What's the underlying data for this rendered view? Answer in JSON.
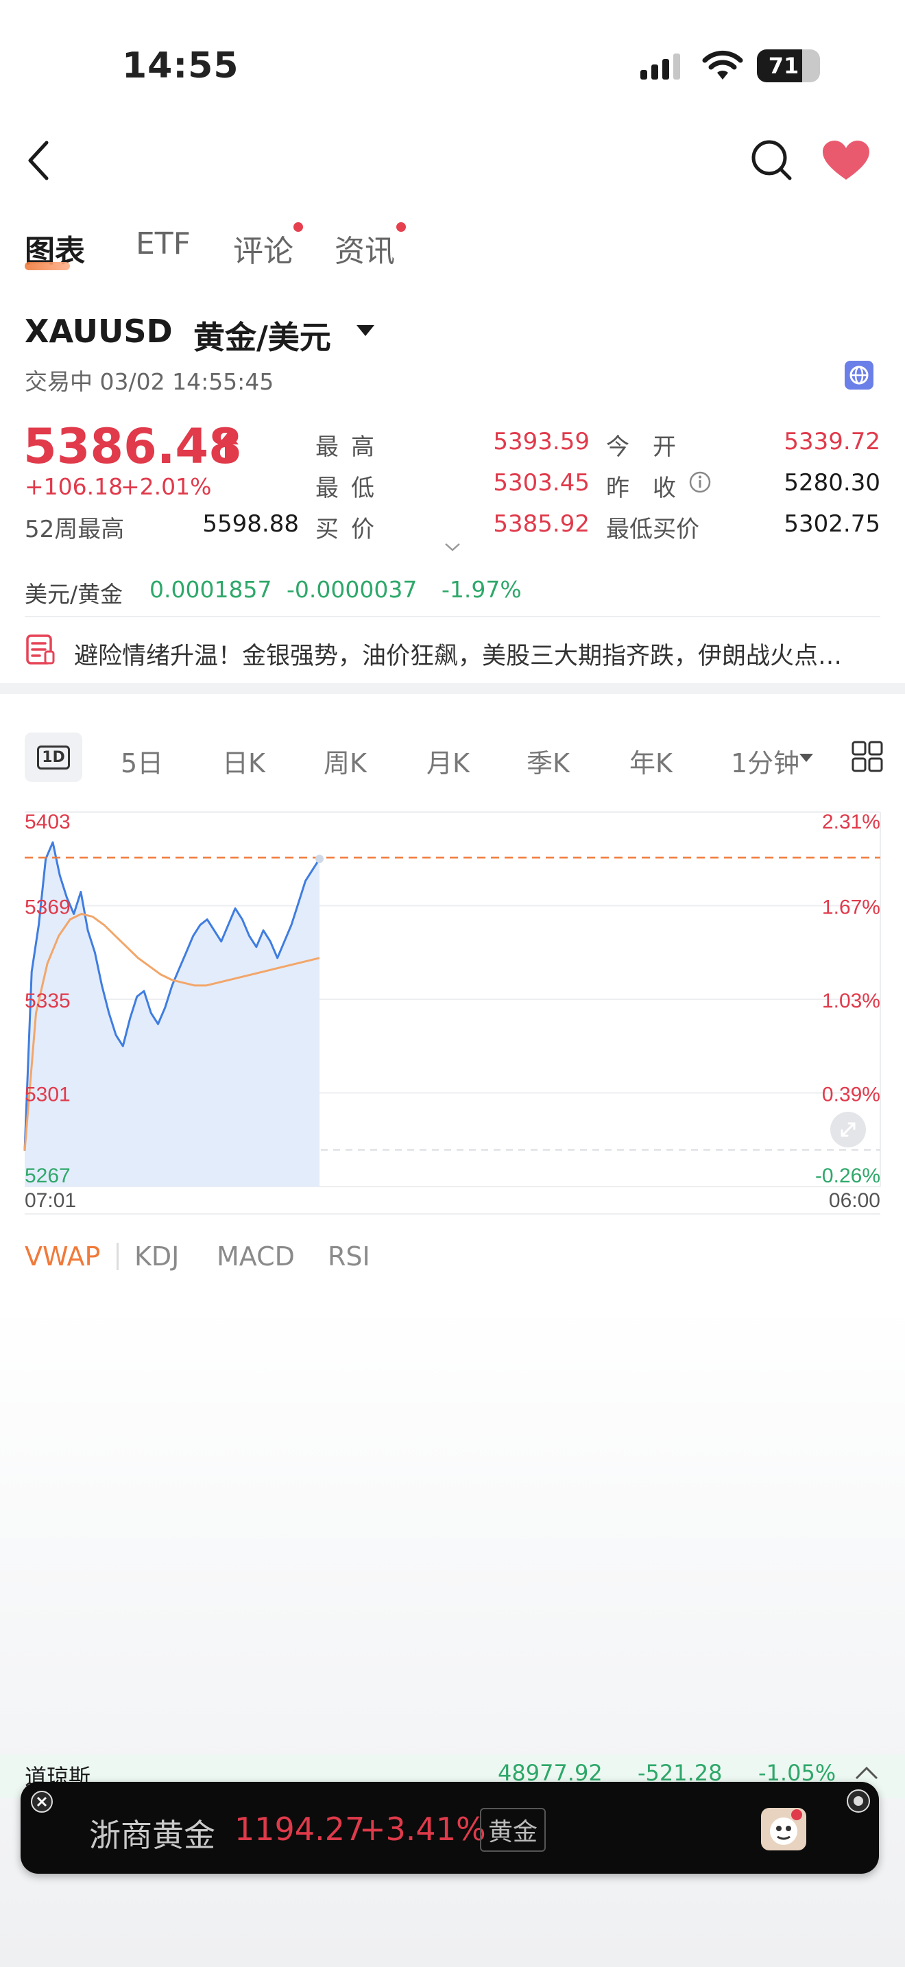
{
  "status_bar": {
    "time": "14:55",
    "battery": "71"
  },
  "tabs": [
    {
      "label": "图表"
    },
    {
      "label": "ETF"
    },
    {
      "label": "评论"
    },
    {
      "label": "资讯"
    }
  ],
  "header": {
    "symbol": "XAUUSD",
    "name": "黄金/美元",
    "status": "交易中 03/02 14:55:45"
  },
  "quote": {
    "price": "5386.48",
    "change": "+106.18",
    "change_pct": "+2.01%",
    "high_label": "最高",
    "high": "5393.59",
    "open_label": "今开",
    "open": "5339.72",
    "low_label": "最低",
    "low": "5303.45",
    "prev_close_label": "昨收",
    "prev_close": "5280.30",
    "w52_label": "52周最高",
    "w52_high": "5598.88",
    "bid_label": "买价",
    "bid": "5385.92",
    "min_bid_label": "最低买价",
    "min_bid": "5302.75"
  },
  "cross": {
    "label": "美元/黄金",
    "value": "0.0001857",
    "change": "-0.0000037",
    "pct": "-1.97%"
  },
  "news": {
    "text": "避险情绪升温！金银强势，油价狂飙，美股三大期指齐跌，伊朗战火点…"
  },
  "timeframes": {
    "active": "1D",
    "items": [
      "5日",
      "日K",
      "周K",
      "月K",
      "季K",
      "年K"
    ],
    "interval": "1分钟"
  },
  "chart_data": {
    "type": "line",
    "y_left_labels": [
      "5403",
      "5369",
      "5335",
      "5301",
      "5267"
    ],
    "y_right_labels": [
      "2.31%",
      "1.67%",
      "1.03%",
      "0.39%",
      "-0.26%"
    ],
    "x_labels": [
      "07:01",
      "06:00"
    ],
    "ylim": [
      5267,
      5403
    ],
    "reference_line": 5280.3,
    "current_line": 5386.48,
    "series": [
      {
        "values": [
          5280,
          5345,
          5362,
          5386,
          5392,
          5380,
          5372,
          5366,
          5374,
          5360,
          5352,
          5340,
          5330,
          5322,
          5318,
          5328,
          5336,
          5338,
          5330,
          5326,
          5332,
          5340,
          5346,
          5352,
          5358,
          5362,
          5364,
          5360,
          5356,
          5362,
          5368,
          5364,
          5358,
          5354,
          5360,
          5356,
          5350,
          5356,
          5362,
          5370,
          5378,
          5382,
          5386
        ]
      },
      {
        "values": [
          5280,
          5330,
          5348,
          5358,
          5364,
          5366,
          5365,
          5362,
          5358,
          5354,
          5350,
          5347,
          5344,
          5342,
          5341,
          5340,
          5340,
          5341,
          5342,
          5343,
          5344,
          5345,
          5346,
          5347,
          5348,
          5349,
          5350
        ]
      }
    ]
  },
  "indicators": {
    "active": "VWAP",
    "items": [
      "KDJ",
      "MACD",
      "RSI"
    ]
  },
  "ticker": {
    "name": "道琼斯",
    "value": "48977.92",
    "change": "-521.28",
    "pct": "-1.05%"
  },
  "promo": {
    "name": "浙商黄金",
    "price": "1194.27",
    "pct": "+3.41%",
    "tag": "黄金"
  },
  "colors": {
    "up": "#e03a4b",
    "down": "#2ea86a",
    "line": "#3f7de0",
    "avg": "#f2a66a",
    "dash": "#f07a3a"
  }
}
